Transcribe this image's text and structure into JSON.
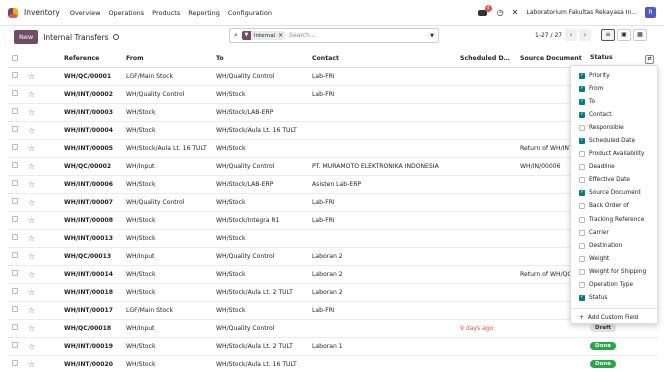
{
  "nav": {
    "app_name": "Inventory",
    "menu": [
      "Overview",
      "Operations",
      "Products",
      "Reporting",
      "Configuration"
    ],
    "chat_badge": "4",
    "company": "Laboratorium Fakultas Rekayasa In...",
    "avatar": "R"
  },
  "control": {
    "new_label": "New",
    "breadcrumb": "Internal Transfers",
    "search_facet": "Internal",
    "search_placeholder": "Search...",
    "pager": "1-27 / 27"
  },
  "table": {
    "columns": [
      "Reference",
      "From",
      "To",
      "Contact",
      "Scheduled Date",
      "Source Document",
      "Status"
    ],
    "rows": [
      {
        "ref": "WH/QC/00001",
        "from": "LGF/Main Stock",
        "to": "WH/Quality Control",
        "contact": "Lab-FRI",
        "date": "",
        "source": "",
        "status": ""
      },
      {
        "ref": "WH/INT/00002",
        "from": "WH/Quality Control",
        "to": "WH/Stock",
        "contact": "Lab-FRI",
        "date": "",
        "source": "",
        "status": ""
      },
      {
        "ref": "WH/INT/00003",
        "from": "WH/Stock",
        "to": "WH/Stock/LAB-ERP",
        "contact": "",
        "date": "",
        "source": "",
        "status": ""
      },
      {
        "ref": "WH/INT/00004",
        "from": "WH/Stock",
        "to": "WH/Stock/Aula Lt. 16 TULT",
        "contact": "",
        "date": "",
        "source": "",
        "status": ""
      },
      {
        "ref": "WH/INT/00005",
        "from": "WH/Stock/Aula Lt. 16 TULT",
        "to": "WH/Stock",
        "contact": "",
        "date": "",
        "source": "Return of WH/INT",
        "status": ""
      },
      {
        "ref": "WH/QC/00002",
        "from": "WH/Input",
        "to": "WH/Quality Control",
        "contact": "PT. MURAMOTO ELEKTRONIKA INDONESIA",
        "date": "",
        "source": "WH/IN/00006",
        "status": ""
      },
      {
        "ref": "WH/INT/00006",
        "from": "WH/Stock",
        "to": "WH/Stock/LAB-ERP",
        "contact": "Asisten Lab-ERP",
        "date": "",
        "source": "",
        "status": ""
      },
      {
        "ref": "WH/INT/00007",
        "from": "WH/Quality Control",
        "to": "WH/Stock",
        "contact": "Lab-FRI",
        "date": "",
        "source": "",
        "status": ""
      },
      {
        "ref": "WH/INT/00008",
        "from": "WH/Stock",
        "to": "WH/Stock/Integra R1",
        "contact": "Lab-FRI",
        "date": "",
        "source": "",
        "status": ""
      },
      {
        "ref": "WH/INT/00013",
        "from": "WH/Stock",
        "to": "WH/Stock",
        "contact": "",
        "date": "",
        "source": "",
        "status": ""
      },
      {
        "ref": "WH/QC/00013",
        "from": "WH/Input",
        "to": "WH/Quality Control",
        "contact": "Laboran 2",
        "date": "",
        "source": "",
        "status": ""
      },
      {
        "ref": "WH/INT/00014",
        "from": "WH/Stock",
        "to": "WH/Stock",
        "contact": "Laboran 2",
        "date": "",
        "source": "Return of WH/QC",
        "status": ""
      },
      {
        "ref": "WH/INT/00018",
        "from": "WH/Stock",
        "to": "WH/Stock/Aula Lt. 2 TULT",
        "contact": "Laboran 2",
        "date": "",
        "source": "",
        "status": ""
      },
      {
        "ref": "WH/INT/00017",
        "from": "LGF/Main Stock",
        "to": "WH/Stock",
        "contact": "Lab-FRI",
        "date": "",
        "source": "",
        "status": ""
      },
      {
        "ref": "WH/QC/00018",
        "from": "WH/Input",
        "to": "WH/Quality Control",
        "contact": "",
        "date": "9 days ago",
        "source": "",
        "status": "Draft"
      },
      {
        "ref": "WH/INT/00019",
        "from": "WH/Stock",
        "to": "WH/Stock/Aula Lt. 2 TULT",
        "contact": "Laboran 1",
        "date": "",
        "source": "",
        "status": "Done"
      },
      {
        "ref": "WH/INT/00020",
        "from": "WH/Stock",
        "to": "WH/Stock/Aula Lt. 16 TULT",
        "contact": "",
        "date": "",
        "source": "",
        "status": "Done"
      }
    ]
  },
  "optional_columns": [
    {
      "label": "Priority",
      "checked": true
    },
    {
      "label": "From",
      "checked": true
    },
    {
      "label": "To",
      "checked": true
    },
    {
      "label": "Contact",
      "checked": true
    },
    {
      "label": "Responsible",
      "checked": false
    },
    {
      "label": "Scheduled Date",
      "checked": true
    },
    {
      "label": "Product Availability",
      "checked": false
    },
    {
      "label": "Deadline",
      "checked": false
    },
    {
      "label": "Effective Date",
      "checked": false
    },
    {
      "label": "Source Document",
      "checked": true
    },
    {
      "label": "Back Order of",
      "checked": false
    },
    {
      "label": "Tracking Reference",
      "checked": false
    },
    {
      "label": "Carrier",
      "checked": false
    },
    {
      "label": "Destination",
      "checked": false
    },
    {
      "label": "Weight",
      "checked": false
    },
    {
      "label": "Weight for Shipping",
      "checked": false
    },
    {
      "label": "Operation Type",
      "checked": false
    },
    {
      "label": "Status",
      "checked": true
    }
  ],
  "add_custom_field": "Add Custom Field",
  "colors": {
    "brand": "#714b67",
    "accent": "#017e84",
    "done": "#28a745",
    "late": "#e4514e"
  }
}
